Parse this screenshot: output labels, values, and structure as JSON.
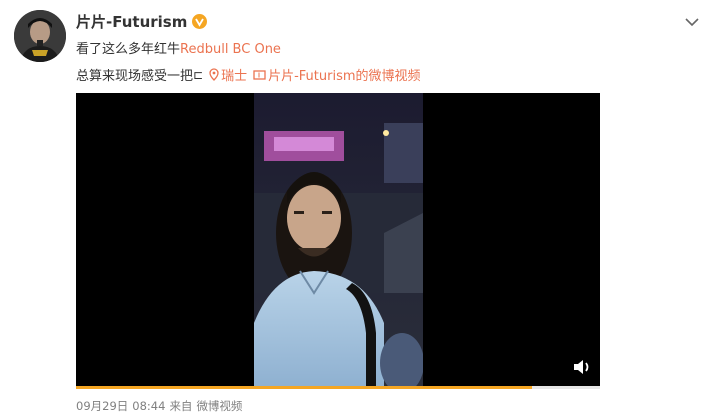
{
  "post": {
    "author": "片片-Futurism",
    "line1_text": "看了这么多年红牛",
    "line1_link": "Redbull BC One",
    "line2_text": "总算来现场感受一把",
    "location": "瑞士",
    "video_link": "片片-Futurism的微博视频",
    "date": "09月29日",
    "time": "08:44",
    "source_prefix": "来自",
    "source": "微博视频"
  },
  "player": {
    "progress": 0.87,
    "accent_color": "#f5a623"
  },
  "icons": {
    "verified": "verified-v-icon",
    "expand": "chevron-down-icon",
    "location": "location-pin-icon",
    "video": "video-icon",
    "sound": "speaker-icon"
  },
  "colors": {
    "link": "#eb7350",
    "text": "#333333",
    "meta": "#808080"
  }
}
